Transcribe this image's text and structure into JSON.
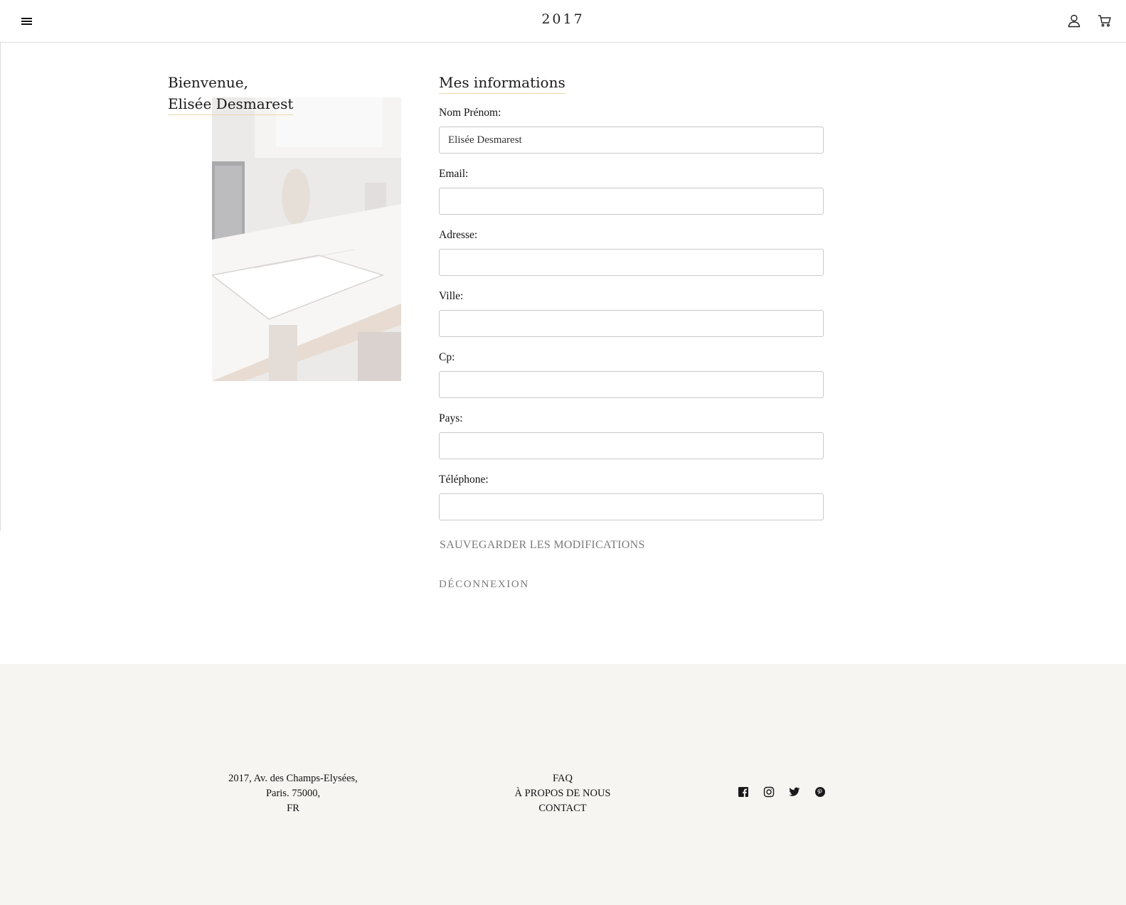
{
  "header": {
    "brand": "2017",
    "menu_icon": "hamburger-menu-icon",
    "account_icon": "user-icon",
    "cart_icon": "cart-icon"
  },
  "welcome": {
    "greeting": "Bienvenue,",
    "name": "Elisée Desmarest"
  },
  "form": {
    "title": "Mes informations",
    "fields": [
      {
        "label": "Nom Prénom:",
        "value": "Elisée Desmarest"
      },
      {
        "label": "Email:",
        "value": ""
      },
      {
        "label": "Adresse:",
        "value": ""
      },
      {
        "label": "Ville:",
        "value": ""
      },
      {
        "label": "Cp:",
        "value": ""
      },
      {
        "label": "Pays:",
        "value": ""
      },
      {
        "label": "Téléphone:",
        "value": ""
      }
    ],
    "save_label": "SAUVEGARDER LES MODIFICATIONS",
    "logout_label": "DÉCONNEXION"
  },
  "footer": {
    "address": [
      "2017, Av. des Champs-Elysées,",
      "Paris. 75000,",
      "FR"
    ],
    "links": [
      "FAQ",
      "À PROPOS DE NOUS",
      "CONTACT"
    ],
    "social_icons": [
      "facebook-icon",
      "instagram-icon",
      "twitter-icon",
      "pinterest-icon"
    ]
  },
  "colors": {
    "accent_underline": "#e9d9a6",
    "footer_bg": "#f6f5f2",
    "muted_text": "#7a7a7a"
  }
}
